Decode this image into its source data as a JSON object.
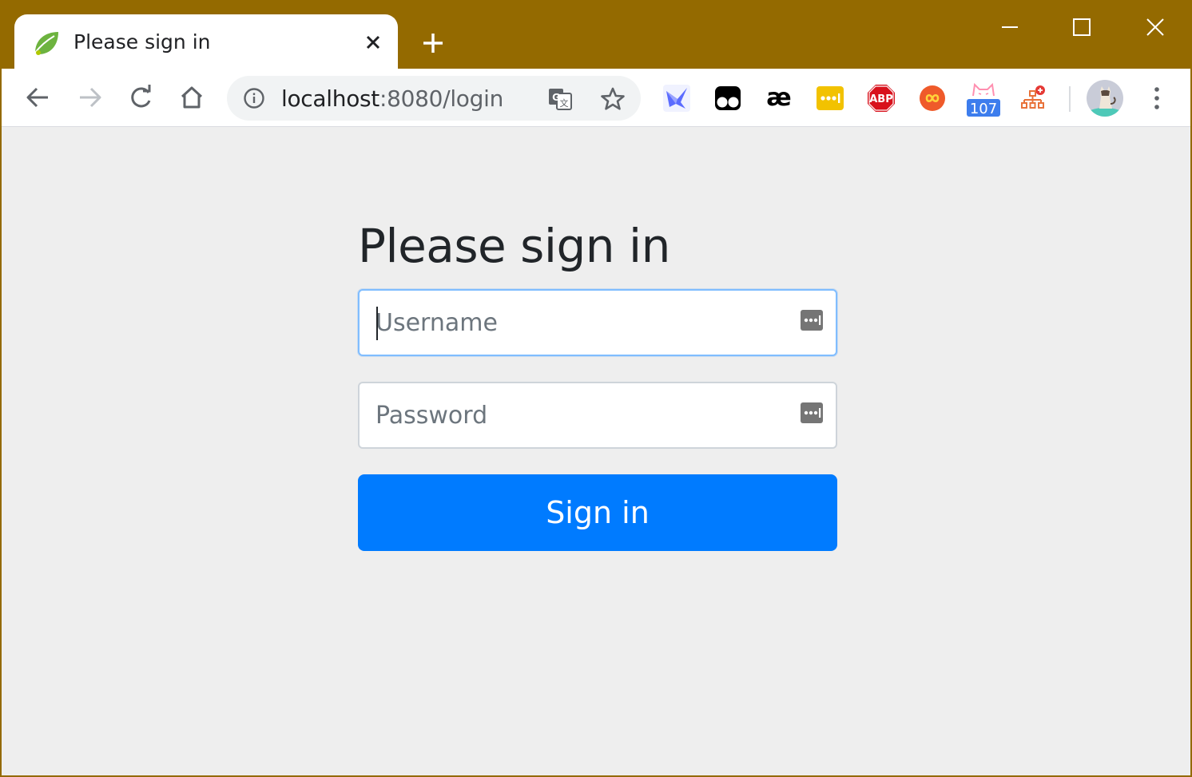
{
  "browser": {
    "tab": {
      "title": "Please sign in"
    },
    "address_bar": {
      "host": "localhost",
      "path": ":8080/login"
    },
    "extensions": [
      {
        "name": "swallow-extension-icon"
      },
      {
        "name": "tampermonkey-extension-icon"
      },
      {
        "name": "ae-extension-icon",
        "label": "æ"
      },
      {
        "name": "lastpass-extension-icon"
      },
      {
        "name": "adblock-plus-extension-icon",
        "label": "ABP"
      },
      {
        "name": "infinity-extension-icon"
      },
      {
        "name": "cat-extension-icon",
        "badge": "107"
      },
      {
        "name": "sitemap-extension-icon"
      }
    ],
    "colors": {
      "frame": "#946a00",
      "toolbar": "#ffffff",
      "omnibox": "#f1f3f4"
    }
  },
  "page": {
    "heading": "Please sign in",
    "username": {
      "placeholder": "Username",
      "value": ""
    },
    "password": {
      "placeholder": "Password",
      "value": ""
    },
    "submit_label": "Sign in",
    "colors": {
      "background": "#eeeeee",
      "primary": "#007bff",
      "focus_border": "#80bdff"
    }
  }
}
